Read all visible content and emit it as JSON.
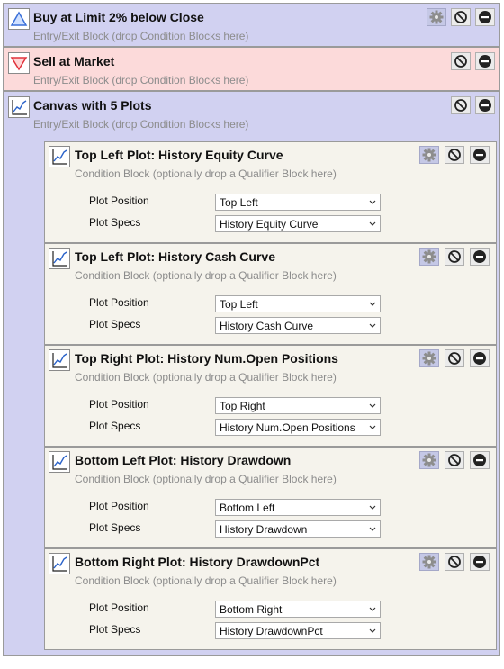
{
  "blocks": [
    {
      "title": "Buy at Limit 2% below Close",
      "subtitle": "Entry/Exit Block (drop Condition Blocks here)",
      "icon": "triangle-up-icon"
    },
    {
      "title": "Sell at Market",
      "subtitle": "Entry/Exit Block (drop Condition Blocks here)",
      "icon": "triangle-down-icon"
    },
    {
      "title": "Canvas with 5 Plots",
      "subtitle": "Entry/Exit Block (drop Condition Blocks here)",
      "icon": "chart-line-icon"
    }
  ],
  "plots": [
    {
      "title": "Top Left Plot: History Equity Curve",
      "subtitle": "Condition Block (optionally drop a Qualifier Block here)",
      "position_label": "Plot Position",
      "position_value": "Top Left",
      "specs_label": "Plot Specs",
      "specs_value": "History Equity Curve"
    },
    {
      "title": "Top Left Plot: History Cash Curve",
      "subtitle": "Condition Block (optionally drop a Qualifier Block here)",
      "position_label": "Plot Position",
      "position_value": "Top Left",
      "specs_label": "Plot Specs",
      "specs_value": "History Cash Curve"
    },
    {
      "title": "Top Right Plot: History Num.Open Positions",
      "subtitle": "Condition Block (optionally drop a Qualifier Block here)",
      "position_label": "Plot Position",
      "position_value": "Top Right",
      "specs_label": "Plot Specs",
      "specs_value": "History Num.Open Positions"
    },
    {
      "title": "Bottom Left Plot: History Drawdown",
      "subtitle": "Condition Block (optionally drop a Qualifier Block here)",
      "position_label": "Plot Position",
      "position_value": "Bottom Left",
      "specs_label": "Plot Specs",
      "specs_value": "History Drawdown"
    },
    {
      "title": "Bottom Right Plot: History DrawdownPct",
      "subtitle": "Condition Block (optionally drop a Qualifier Block here)",
      "position_label": "Plot Position",
      "position_value": "Bottom Right",
      "specs_label": "Plot Specs",
      "specs_value": "History DrawdownPct"
    }
  ],
  "icons": {
    "buttons": [
      "gear-icon",
      "disable-icon",
      "remove-icon"
    ],
    "dropdown": "chevron-down-icon"
  },
  "colors": {
    "block_background": "#d1d1f1",
    "sell_background": "#fcdada",
    "plot_background": "#f5f3ec",
    "triangle_up": "#3a6fd8",
    "triangle_down": "#e0303a",
    "gear_button": "#c5c8e6"
  }
}
